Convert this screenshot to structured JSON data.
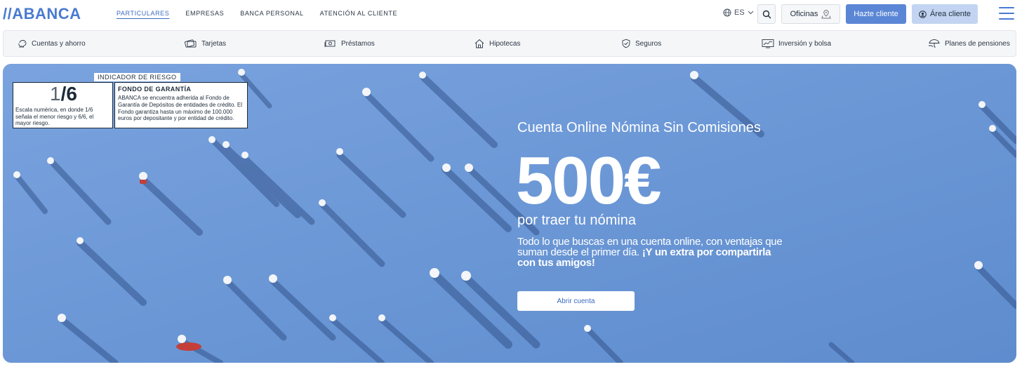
{
  "header": {
    "logo_text": "//ABANCA",
    "nav": [
      "PARTICULARES",
      "EMPRESAS",
      "BANCA PERSONAL",
      "ATENCIÓN AL CLIENTE"
    ],
    "lang": "ES",
    "oficinas_label": "Oficinas",
    "hazte_label": "Hazte cliente",
    "area_label": "Área cliente",
    "colors": {
      "brand": "#4a7bd0",
      "primary_button": "#5b86d6",
      "secondary_button": "#c3d4f2"
    }
  },
  "categories": [
    {
      "label": "Cuentas y ahorro",
      "icon": "piggy-bank-icon"
    },
    {
      "label": "Tarjetas",
      "icon": "card-icon"
    },
    {
      "label": "Préstamos",
      "icon": "money-icon"
    },
    {
      "label": "Hipotecas",
      "icon": "house-icon"
    },
    {
      "label": "Seguros",
      "icon": "shield-icon"
    },
    {
      "label": "Inversión y bolsa",
      "icon": "chart-icon"
    },
    {
      "label": "Planes de pensiones",
      "icon": "umbrella-icon"
    }
  ],
  "risk": {
    "label": "INDICADOR DE RIESGO",
    "value_num": "1",
    "value_den": "/6",
    "description": "Escala numérica, en donde 1/6 señala el menor riesgo y 6/6, el mayor riesgo.",
    "fondo_title": "FONDO DE GARANTÍA",
    "fondo_text": "ABANCA se encuentra adherida al Fondo de Garantía de Depósitos de entidades de crédito. El Fondo garantiza hasta un máximo de 100.000 euros por depositante y por entidad de crédito."
  },
  "hero": {
    "subtitle": "Cuenta Online Nómina Sin Comisiones",
    "amount": "500€",
    "tagline": "por traer tu nómina",
    "desc_plain": "Todo lo que buscas en una cuenta online, con ventajas que suman desde el primer día. ",
    "desc_bold": "¡Y un extra por compartirla con tus amigos!",
    "cta_label": "Abrir cuenta"
  }
}
